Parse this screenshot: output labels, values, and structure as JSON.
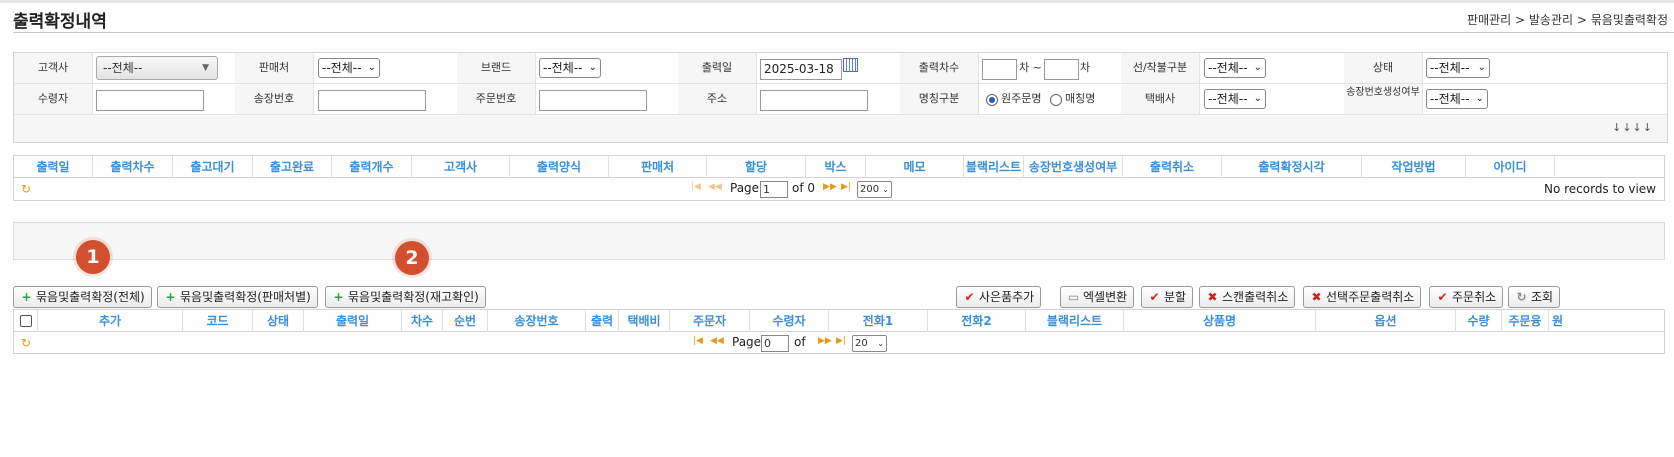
{
  "page": {
    "title": "출력확정내역",
    "breadcrumb": "판매관리 > 발송관리 > 묶음및출력확정"
  },
  "search": {
    "row1": {
      "customer_label": "고객사",
      "customer_value": "--전체--",
      "seller_label": "판매처",
      "seller_value": "--전체--",
      "brand_label": "브랜드",
      "brand_value": "--전체--",
      "print_date_label": "출력일",
      "print_date_value": "2025-03-18",
      "print_seq_label": "출력차수",
      "print_seq_from": "",
      "print_seq_unit1": "차 ~",
      "print_seq_to": "",
      "print_seq_unit2": "차",
      "prepay_label": "선/착불구분",
      "prepay_value": "--전체--",
      "status_label": "상태",
      "status_value": "--전체--"
    },
    "row2": {
      "receiver_label": "수령자",
      "receiver_value": "",
      "invoice_label": "송장번호",
      "invoice_value": "",
      "order_no_label": "주문번호",
      "order_no_value": "",
      "address_label": "주소",
      "address_value": "",
      "name_type_label": "명칭구분",
      "name_type_opt1": "원주문명",
      "name_type_opt2": "매칭명",
      "courier_label": "택배사",
      "courier_value": "--전체--",
      "invoice_gen_label": "송장번호생성여부",
      "invoice_gen_value": "--전체--"
    },
    "expand_arrows": "↓↓↓↓"
  },
  "grid1": {
    "columns": [
      "출력일",
      "출력차수",
      "출고대기",
      "출고완료",
      "출력개수",
      "고객사",
      "출력양식",
      "판매처",
      "할당",
      "박스",
      "메모",
      "블랙리스트",
      "송장번호생성여부",
      "출력취소",
      "출력확정시각",
      "작업방법",
      "아이디"
    ],
    "pager": {
      "page_label": "Page",
      "page_value": "1",
      "of_label": "of 0",
      "rows_value": "200",
      "records_text": "No records to view"
    }
  },
  "badges": [
    "1",
    "2"
  ],
  "buttons": {
    "bundle_all": "묶음및출력확정(전체)",
    "bundle_seller": "묶음및출력확정(판매처별)",
    "bundle_stock": "묶음및출력확정(재고확인)",
    "add_gift": "사은품추가",
    "excel": "엑셀변환",
    "split": "분할",
    "scan_cancel": "스캔출력취소",
    "select_cancel": "선택주문출력취소",
    "order_cancel": "주문취소",
    "search": "조회"
  },
  "grid2": {
    "columns": [
      "추가",
      "코드",
      "상태",
      "출력일",
      "차수",
      "순번",
      "송장번호",
      "출력",
      "택배비",
      "주문자",
      "수령자",
      "전화1",
      "전화2",
      "블랙리스트",
      "상품명",
      "옵션",
      "수량",
      "주문융",
      "원"
    ],
    "pager": {
      "page_label": "Page",
      "page_value": "0",
      "of_label": "of",
      "rows_value": "20"
    }
  },
  "colors": {
    "header_text": "#3a8fd9",
    "badge": "#d2502f",
    "pager_icon": "#e59a1b"
  }
}
